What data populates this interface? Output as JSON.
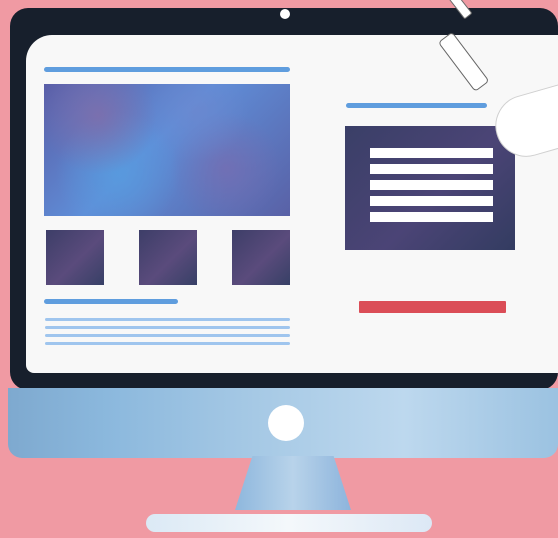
{
  "colors": {
    "background": "#f09aa3",
    "bezel": "#171f2c",
    "screen": "#f8f8f8",
    "accent_blue": "#5f9dde",
    "light_blue": "#9fc5ee",
    "dark_panel": "#3a3f67",
    "button_red": "#db4d57",
    "white": "#ffffff"
  },
  "icons": {
    "camera": "camera-dot",
    "chin_button": "power-button",
    "pointer": "stylus"
  }
}
